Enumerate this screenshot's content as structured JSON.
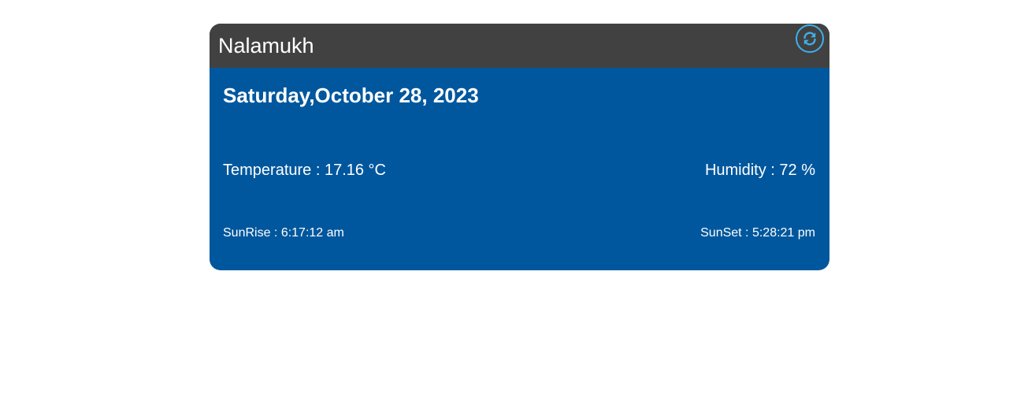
{
  "weather_card": {
    "city": "Nalamukh",
    "date": "Saturday,October 28, 2023",
    "temperature": "Temperature : 17.16 °C",
    "humidity": "Humidity : 72 %",
    "sunrise": "SunRise : 6:17:12 am",
    "sunset": "SunSet : 5:28:21 pm"
  },
  "icons": {
    "refresh": "refresh-icon"
  },
  "colors": {
    "header": "#414141",
    "card_body": "#00579d",
    "accent": "#3fb0ea",
    "text": "#ffffff"
  }
}
